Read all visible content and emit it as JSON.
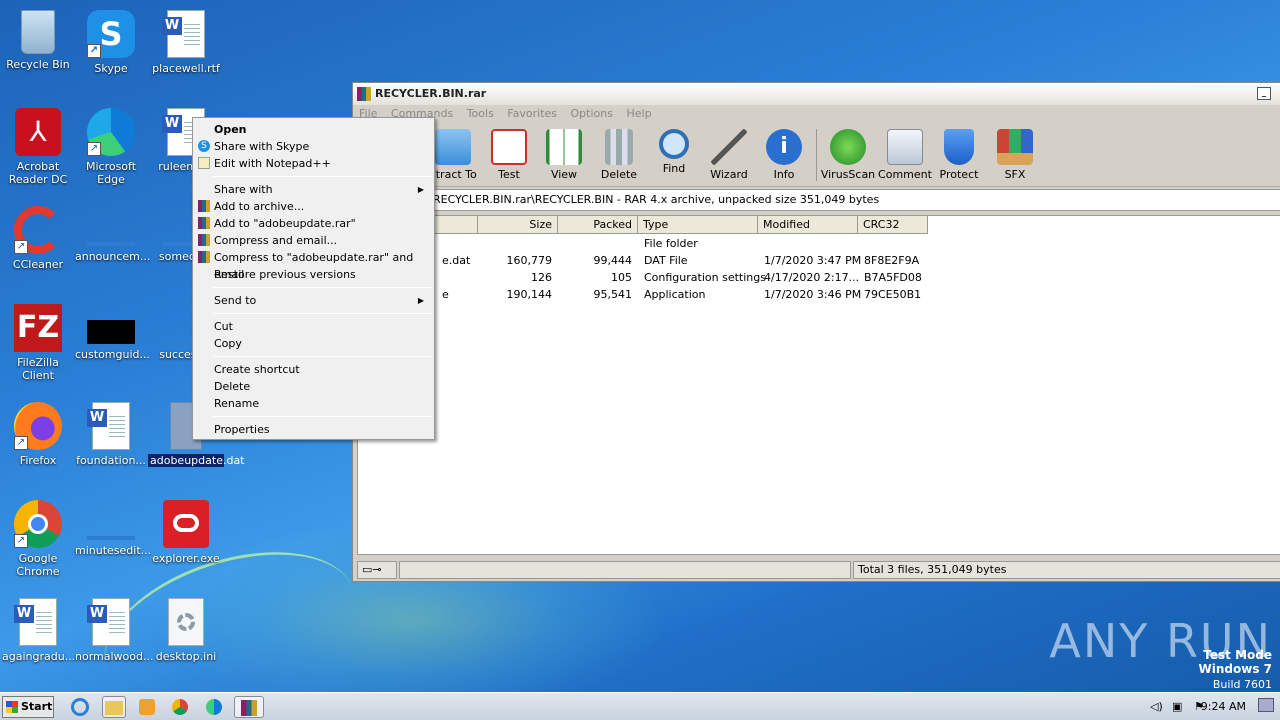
{
  "desktop": {
    "icons": [
      {
        "label": "Recycle Bin"
      },
      {
        "label": "Skype"
      },
      {
        "label": "placewell.rtf"
      },
      {
        "label": "Acrobat Reader DC"
      },
      {
        "label": "Microsoft Edge"
      },
      {
        "label": "ruleengi..."
      },
      {
        "label": "CCleaner"
      },
      {
        "label": "announcem..."
      },
      {
        "label": "someon..."
      },
      {
        "label": "FileZilla Client"
      },
      {
        "label": "customguid..."
      },
      {
        "label": "success..."
      },
      {
        "label": "Firefox"
      },
      {
        "label": "foundation..."
      },
      {
        "label": "adobeupdate.dat"
      },
      {
        "label": "Google Chrome"
      },
      {
        "label": "minutesedit..."
      },
      {
        "label": "explorer.exe"
      },
      {
        "label": "againgradu..."
      },
      {
        "label": "normalwood..."
      },
      {
        "label": "desktop.ini"
      }
    ]
  },
  "winrar": {
    "title": "RECYCLER.BIN.rar",
    "menu": [
      "File",
      "Commands",
      "Tools",
      "Favorites",
      "Options",
      "Help"
    ],
    "toolbar": [
      "xtract To",
      "Test",
      "View",
      "Delete",
      "Find",
      "Wizard",
      "Info",
      "VirusScan",
      "Comment",
      "Protect",
      "SFX"
    ],
    "path": "RECYCLER.BIN.rar\\RECYCLER.BIN - RAR 4.x archive, unpacked size 351,049 bytes",
    "columns": [
      "Size",
      "Packed",
      "Type",
      "Modified",
      "CRC32"
    ],
    "rows": [
      {
        "name": "",
        "size": "",
        "packed": "",
        "type": "File folder",
        "modified": "",
        "crc": ""
      },
      {
        "name": "e.dat",
        "size": "160,779",
        "packed": "99,444",
        "type": "DAT File",
        "modified": "1/7/2020 3:47 PM",
        "crc": "8F8E2F9A"
      },
      {
        "name": "",
        "size": "126",
        "packed": "105",
        "type": "Configuration settings",
        "modified": "4/17/2020 2:17...",
        "crc": "B7A5FD08"
      },
      {
        "name": "e",
        "size": "190,144",
        "packed": "95,541",
        "type": "Application",
        "modified": "1/7/2020 3:46 PM",
        "crc": "79CE50B1"
      }
    ],
    "status": "Total 3 files, 351,049 bytes"
  },
  "context_menu": {
    "items": [
      {
        "label": "Open"
      },
      {
        "label": "Share with Skype"
      },
      {
        "label": "Edit with Notepad++"
      },
      {
        "label": "Share with"
      },
      {
        "label": "Add to archive..."
      },
      {
        "label": "Add to \"adobeupdate.rar\""
      },
      {
        "label": "Compress and email..."
      },
      {
        "label": "Compress to \"adobeupdate.rar\" and email"
      },
      {
        "label": "Restore previous versions"
      },
      {
        "label": "Send to"
      },
      {
        "label": "Cut"
      },
      {
        "label": "Copy"
      },
      {
        "label": "Create shortcut"
      },
      {
        "label": "Delete"
      },
      {
        "label": "Rename"
      },
      {
        "label": "Properties"
      }
    ]
  },
  "taskbar": {
    "start_label": "Start",
    "clock": "9:24 AM"
  },
  "watermark": {
    "brand": "ANY RUN",
    "line1": "Test Mode",
    "line2": "Windows 7",
    "line3": "Build 7601"
  },
  "colors": {
    "desktop": "#1f6fc8",
    "selection": "#0a246a"
  }
}
